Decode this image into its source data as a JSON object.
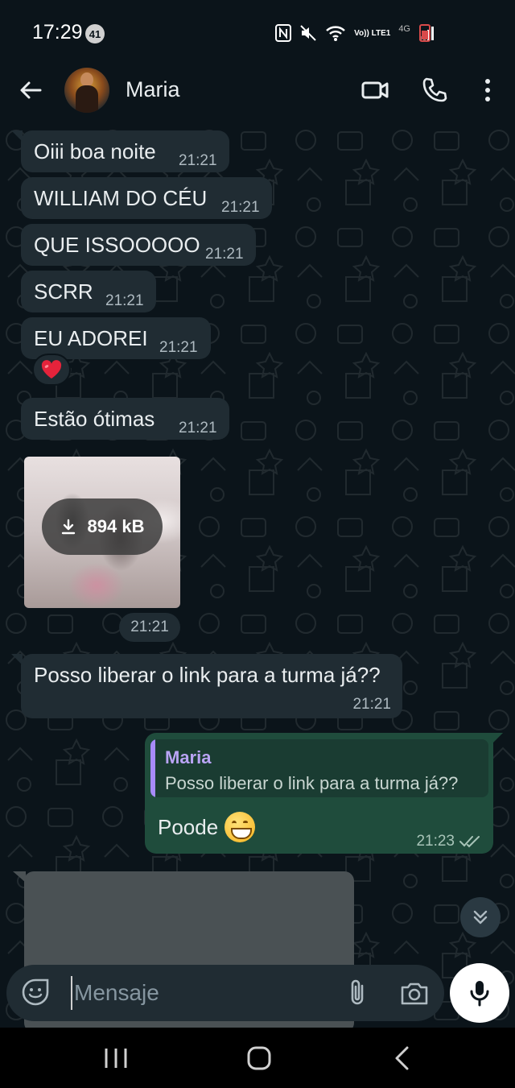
{
  "status_bar": {
    "time": "17:29",
    "notification_count": "41",
    "network_label": "Vo)) LTE1",
    "network_type": "4G",
    "battery_color": "#d94a4a"
  },
  "header": {
    "contact_name": "Maria"
  },
  "messages_in": [
    {
      "text": "Oiii boa noite",
      "time": "21:21"
    },
    {
      "text": "WILLIAM DO CÉU",
      "time": "21:21"
    },
    {
      "text": "QUE ISSOOOOO",
      "time": "21:21"
    },
    {
      "text": "SCRR",
      "time": "21:21"
    },
    {
      "text": "EU ADOREI",
      "time": "21:21",
      "reaction": "heart"
    },
    {
      "text": "Estão ótimas",
      "time": "21:21"
    }
  ],
  "media_message": {
    "size_label": "894 kB",
    "time": "21:21"
  },
  "long_message": {
    "text": "Posso liberar o link para a turma já??",
    "time": "21:21"
  },
  "outgoing": {
    "quote_name": "Maria",
    "quote_text": "Posso liberar o link para a turma já??",
    "text": "Poode",
    "emoji": "grinning-face",
    "time": "21:23",
    "status": "read-double-check"
  },
  "composer": {
    "placeholder": "Mensaje"
  },
  "colors": {
    "background": "#0b141a",
    "incoming_bubble": "#202c33",
    "outgoing_bubble": "#1f4c3c",
    "quote_accent": "#a78bfa"
  }
}
